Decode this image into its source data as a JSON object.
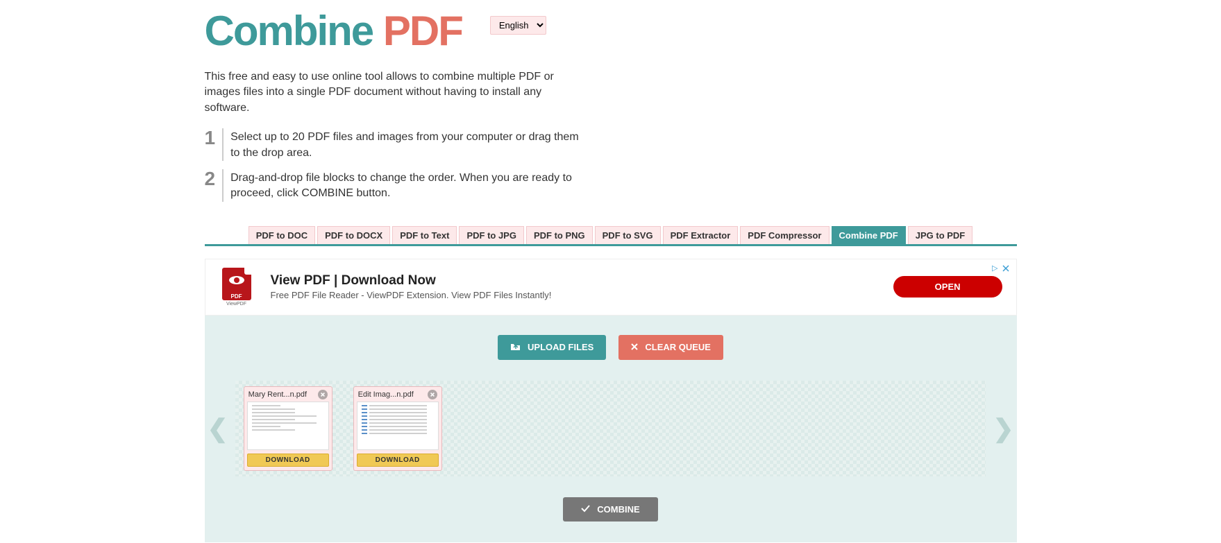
{
  "header": {
    "logo_a": "Combine",
    "logo_b": "PDF",
    "language": "English",
    "language_options": [
      "English"
    ]
  },
  "intro": "This free and easy to use online tool allows to combine multiple PDF or images files into a single PDF document without having to install any software.",
  "steps": [
    {
      "num": "1",
      "text": "Select up to 20 PDF files and images from your computer or drag them to the drop area."
    },
    {
      "num": "2",
      "text": "Drag-and-drop file blocks to change the order. When you are ready to proceed, click COMBINE button."
    }
  ],
  "tabs": [
    {
      "label": "PDF to DOC",
      "active": false
    },
    {
      "label": "PDF to DOCX",
      "active": false
    },
    {
      "label": "PDF to Text",
      "active": false
    },
    {
      "label": "PDF to JPG",
      "active": false
    },
    {
      "label": "PDF to PNG",
      "active": false
    },
    {
      "label": "PDF to SVG",
      "active": false
    },
    {
      "label": "PDF Extractor",
      "active": false
    },
    {
      "label": "PDF Compressor",
      "active": false
    },
    {
      "label": "Combine PDF",
      "active": true
    },
    {
      "label": "JPG to PDF",
      "active": false
    }
  ],
  "ad": {
    "badge": "PDF",
    "badge_sub": "ViewPDF",
    "title": "View PDF | Download Now",
    "desc": "Free PDF File Reader - ViewPDF Extension. View PDF Files Instantly!",
    "open_label": "OPEN",
    "info_icon": "▷"
  },
  "buttons": {
    "upload": "UPLOAD FILES",
    "clear": "CLEAR QUEUE",
    "combine": "COMBINE"
  },
  "files": [
    {
      "name": "Mary Rent...n.pdf",
      "download": "DOWNLOAD",
      "style": "text"
    },
    {
      "name": "Edit Imag...n.pdf",
      "download": "DOWNLOAD",
      "style": "list"
    }
  ],
  "nav": {
    "prev": "❮",
    "next": "❯"
  }
}
